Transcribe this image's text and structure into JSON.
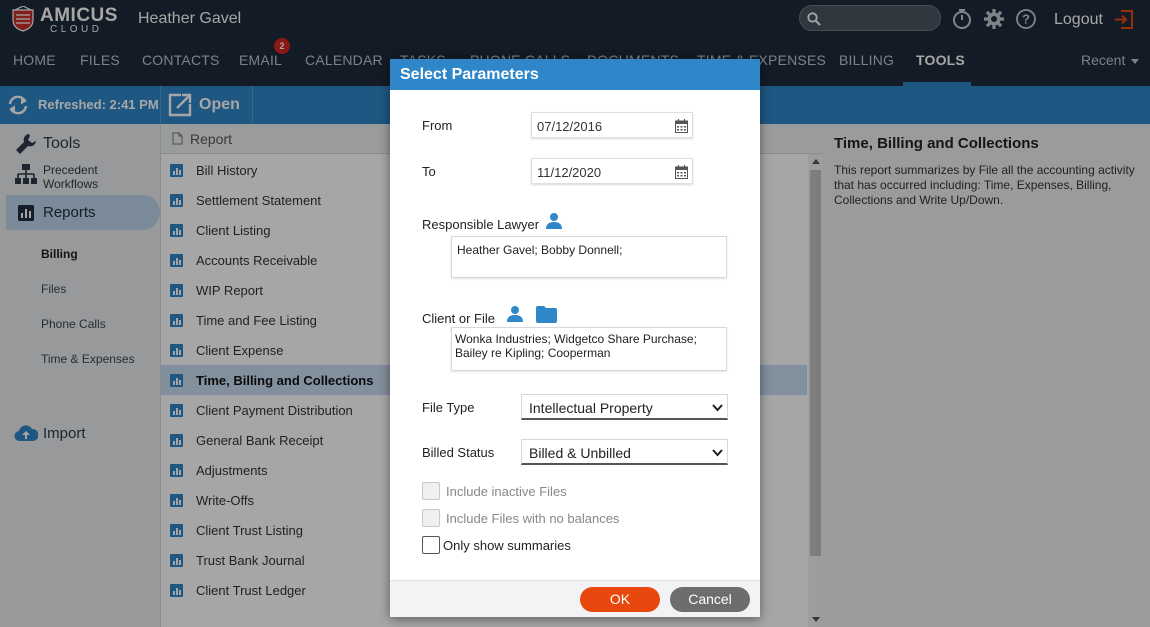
{
  "header": {
    "logo_text": "AMICUS",
    "logo_subtext": "CLOUD",
    "user_name": "Heather Gavel",
    "logout_label": "Logout"
  },
  "nav": {
    "items": [
      {
        "label": "HOME"
      },
      {
        "label": "FILES"
      },
      {
        "label": "CONTACTS"
      },
      {
        "label": "EMAIL"
      },
      {
        "label": "CALENDAR"
      },
      {
        "label": "TASKS"
      },
      {
        "label": "PHONE CALLS"
      },
      {
        "label": "DOCUMENTS"
      },
      {
        "label": "TIME & EXPENSES"
      },
      {
        "label": "BILLING"
      },
      {
        "label": "TOOLS"
      }
    ],
    "email_badge": "2",
    "active": "TOOLS",
    "recent_label": "Recent"
  },
  "toolbar": {
    "refreshed_label": "Refreshed: 2:41 PM",
    "open_label": "Open"
  },
  "sidebar": {
    "tools_label": "Tools",
    "precedent_label": "Precedent Workflows",
    "reports_label": "Reports",
    "sub_items": [
      {
        "label": "Billing"
      },
      {
        "label": "Files"
      },
      {
        "label": "Phone Calls"
      },
      {
        "label": "Time & Expenses"
      }
    ],
    "import_label": "Import"
  },
  "reports": {
    "column_header": "Report",
    "items": [
      {
        "label": "Bill History"
      },
      {
        "label": "Settlement Statement"
      },
      {
        "label": "Client Listing"
      },
      {
        "label": "Accounts Receivable"
      },
      {
        "label": "WIP Report"
      },
      {
        "label": "Time and Fee Listing"
      },
      {
        "label": "Client Expense"
      },
      {
        "label": "Time, Billing and Collections"
      },
      {
        "label": "Client Payment Distribution"
      },
      {
        "label": "General Bank Receipt"
      },
      {
        "label": "Adjustments"
      },
      {
        "label": "Write-Offs"
      },
      {
        "label": "Client Trust Listing"
      },
      {
        "label": "Trust Bank Journal"
      },
      {
        "label": "Client Trust Ledger"
      }
    ],
    "selected": "Time, Billing and Collections"
  },
  "description": {
    "title": "Time, Billing and Collections",
    "text": "This report summarizes by File all the accounting activity that has occurred including: Time, Expenses, Billing, Collections and Write Up/Down."
  },
  "modal": {
    "title": "Select Parameters",
    "from_label": "From",
    "from_value": "07/12/2016",
    "to_label": "To",
    "to_value": "11/12/2020",
    "lawyer_label": "Responsible Lawyer",
    "lawyer_value": "Heather Gavel; Bobby Donnell;",
    "client_label": "Client or File",
    "client_value": "Wonka Industries; Widgetco Share Purchase; Bailey re Kipling; Cooperman",
    "file_type_label": "File Type",
    "file_type_value": "Intellectual Property",
    "billed_status_label": "Billed Status",
    "billed_status_value": "Billed & Unbilled",
    "include_inactive_label": "Include inactive Files",
    "include_no_balance_label": "Include Files with no balances",
    "only_summaries_label": "Only show summaries",
    "ok_label": "OK",
    "cancel_label": "Cancel"
  },
  "colors": {
    "topbar": "#1c2a3b",
    "accent": "#2f86c8",
    "ok_button": "#e8470d",
    "cancel_button": "#6d6d6d"
  }
}
